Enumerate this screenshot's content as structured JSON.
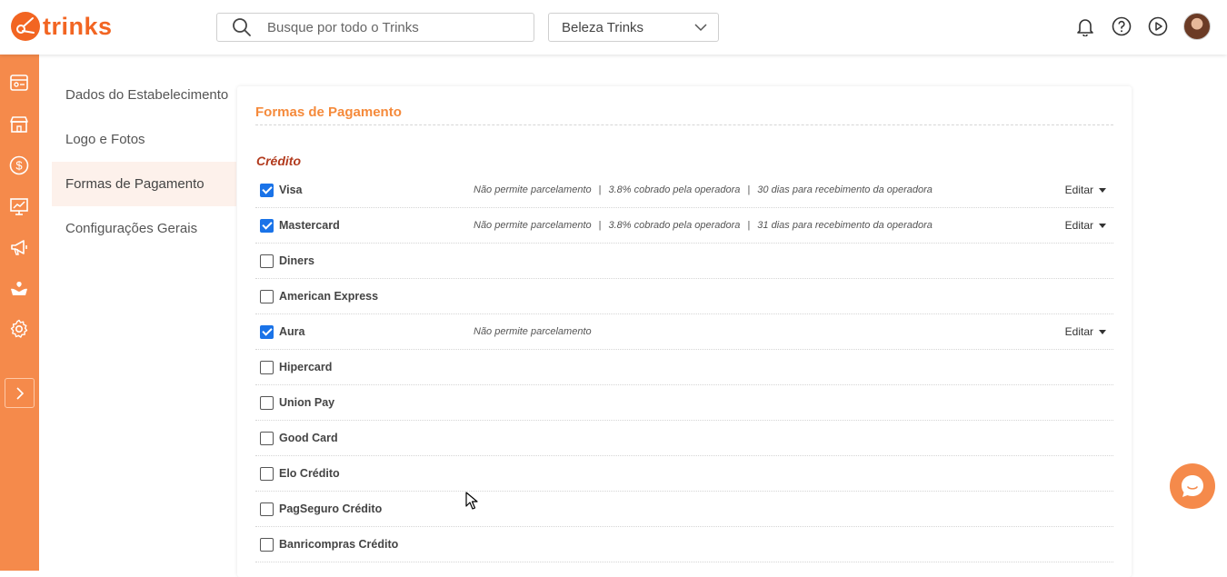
{
  "header": {
    "brand": "trinks",
    "search": {
      "placeholder": "Busque por todo o Trinks"
    },
    "establishment": {
      "selected": "Beleza Trinks"
    },
    "icons": [
      "bell-icon",
      "help-icon",
      "play-icon",
      "avatar"
    ]
  },
  "rail": {
    "icons": [
      "agenda-icon",
      "store-icon",
      "money-icon",
      "reports-icon",
      "marketing-icon",
      "care-icon",
      "settings-icon"
    ],
    "expand_icon": "chevron-right-icon",
    "color": "#f58a4b"
  },
  "submenu": {
    "items": [
      {
        "label": "Dados do Estabelecimento",
        "active": false
      },
      {
        "label": "Logo e Fotos",
        "active": false
      },
      {
        "label": "Formas de Pagamento",
        "active": true
      },
      {
        "label": "Configurações Gerais",
        "active": false
      }
    ]
  },
  "main": {
    "title": "Formas de Pagamento",
    "section_title": "Crédito",
    "edit_label": "Editar",
    "methods": [
      {
        "name": "Visa",
        "checked": true,
        "info": [
          "Não permite parcelamento",
          "3.8% cobrado pela operadora",
          "30 dias para recebimento da operadora"
        ]
      },
      {
        "name": "Mastercard",
        "checked": true,
        "info": [
          "Não permite parcelamento",
          "3.8% cobrado pela operadora",
          "31 dias para recebimento da operadora"
        ]
      },
      {
        "name": "Diners",
        "checked": false,
        "info": []
      },
      {
        "name": "American Express",
        "checked": false,
        "info": []
      },
      {
        "name": "Aura",
        "checked": true,
        "info": [
          "Não permite parcelamento"
        ]
      },
      {
        "name": "Hipercard",
        "checked": false,
        "info": []
      },
      {
        "name": "Union Pay",
        "checked": false,
        "info": []
      },
      {
        "name": "Good Card",
        "checked": false,
        "info": []
      },
      {
        "name": "Elo Crédito",
        "checked": false,
        "info": []
      },
      {
        "name": "PagSeguro Crédito",
        "checked": false,
        "info": []
      },
      {
        "name": "Banricompras Crédito",
        "checked": false,
        "info": []
      }
    ]
  },
  "colors": {
    "accent": "#f58a4b",
    "title": "#f58a3b",
    "section": "#b23b1e",
    "checkbox": "#1a73e8"
  }
}
